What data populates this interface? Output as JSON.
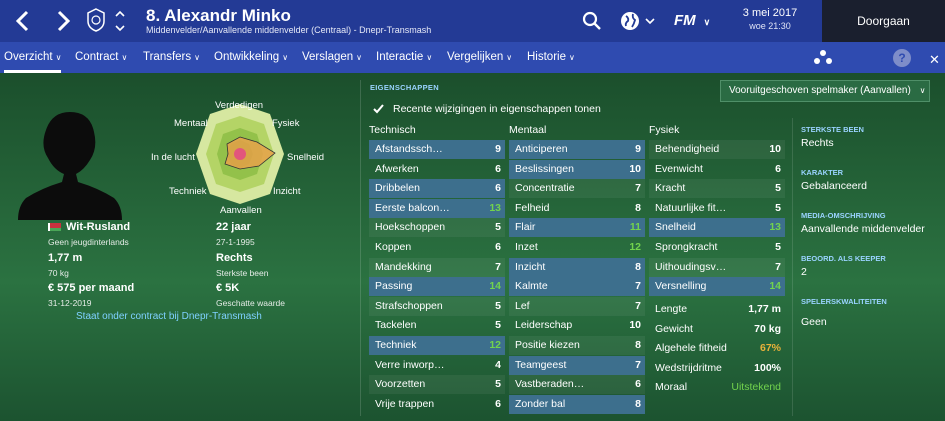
{
  "colors": {
    "topbar": "#233a95",
    "tabbar": "#2f4bb0",
    "continue_bg": "#1a1f2e",
    "highlight_row": "#3d6f8d",
    "good_value": "#72d34d",
    "ok_value": "#ffffff",
    "accent_label": "#9ad3ff",
    "link": "#7fd1ff",
    "orange": "#e9b23a"
  },
  "header": {
    "title": "8. Alexandr Minko",
    "subtitle": "Middenvelder/Aanvallende middenvelder (Centraal) - Dnepr-Transmash",
    "date": "3 mei 2017",
    "time": "woe 21:30",
    "continue_label": "Doorgaan",
    "icons": [
      "back-arrow-icon",
      "forward-arrow-icon",
      "club-crest-icon",
      "search-icon",
      "globe-icon",
      "fm-logo-icon"
    ],
    "fm_label": "FM"
  },
  "tabs": [
    {
      "label": "Overzicht",
      "active": true
    },
    {
      "label": "Contract"
    },
    {
      "label": "Transfers"
    },
    {
      "label": "Ontwikkeling"
    },
    {
      "label": "Verslagen"
    },
    {
      "label": "Interactie"
    },
    {
      "label": "Vergelijken"
    },
    {
      "label": "Historie"
    }
  ],
  "tab_icons": {
    "squad": "squad-icon",
    "help": "?",
    "close": "✕"
  },
  "radar": {
    "labels": {
      "top": "Verdedigen",
      "top_left": "Mentaal",
      "top_right": "Fysiek",
      "left": "In de lucht",
      "right": "Snelheid",
      "bottom_left": "Techniek",
      "bottom_right": "Inzicht",
      "bottom": "Aanvallen"
    }
  },
  "player": {
    "nationality": "Wit-Rusland",
    "caps": "Geen jeugdinterlands",
    "age": "22 jaar",
    "dob": "27-1-1995",
    "height": "1,77 m",
    "weight": "70 kg",
    "foot": "Rechts",
    "foot_sub": "Sterkste been",
    "wage": "€ 575 per maand",
    "contract_end": "31-12-2019",
    "value": "€ 5K",
    "value_sub": "Geschatte waarde",
    "contract_link": "Staat onder contract bij Dnepr-Transmash"
  },
  "attributes": {
    "section_label": "EIGENSCHAPPEN",
    "checkbox_label": "Recente wijzigingen in eigenschappen tonen",
    "role_select": "Vooruitgeschoven spelmaker (Aanvallen)",
    "technical_head": "Technisch",
    "mental_head": "Mentaal",
    "physical_head": "Fysiek",
    "technical": [
      {
        "name": "Afstandssch…",
        "val": "9",
        "hl": true
      },
      {
        "name": "Afwerken",
        "val": "6"
      },
      {
        "name": "Dribbelen",
        "val": "6",
        "hl": true
      },
      {
        "name": "Eerste balcon…",
        "val": "13",
        "hl": true
      },
      {
        "name": "Hoekschoppen",
        "val": "5"
      },
      {
        "name": "Koppen",
        "val": "6"
      },
      {
        "name": "Mandekking",
        "val": "7"
      },
      {
        "name": "Passing",
        "val": "14",
        "hl": true
      },
      {
        "name": "Strafschoppen",
        "val": "5"
      },
      {
        "name": "Tackelen",
        "val": "5"
      },
      {
        "name": "Techniek",
        "val": "12",
        "hl": true
      },
      {
        "name": "Verre inworp…",
        "val": "4"
      },
      {
        "name": "Voorzetten",
        "val": "5"
      },
      {
        "name": "Vrije trappen",
        "val": "6"
      }
    ],
    "mental": [
      {
        "name": "Anticiperen",
        "val": "9",
        "hl": true
      },
      {
        "name": "Beslissingen",
        "val": "10",
        "hl": true
      },
      {
        "name": "Concentratie",
        "val": "7"
      },
      {
        "name": "Felheid",
        "val": "8"
      },
      {
        "name": "Flair",
        "val": "11",
        "hl": true
      },
      {
        "name": "Inzet",
        "val": "12"
      },
      {
        "name": "Inzicht",
        "val": "8",
        "hl": true
      },
      {
        "name": "Kalmte",
        "val": "7",
        "hl": true
      },
      {
        "name": "Lef",
        "val": "7"
      },
      {
        "name": "Leiderschap",
        "val": "10"
      },
      {
        "name": "Positie kiezen",
        "val": "8"
      },
      {
        "name": "Teamgeest",
        "val": "7",
        "hl": true
      },
      {
        "name": "Vastberaden…",
        "val": "6"
      },
      {
        "name": "Zonder bal",
        "val": "8",
        "hl": true
      }
    ],
    "physical": [
      {
        "name": "Behendigheid",
        "val": "10"
      },
      {
        "name": "Evenwicht",
        "val": "6"
      },
      {
        "name": "Kracht",
        "val": "5"
      },
      {
        "name": "Natuurlijke fit…",
        "val": "5"
      },
      {
        "name": "Snelheid",
        "val": "13",
        "hl": true
      },
      {
        "name": "Sprongkracht",
        "val": "5"
      },
      {
        "name": "Uithoudingsv…",
        "val": "7"
      },
      {
        "name": "Versnelling",
        "val": "14",
        "hl": true
      }
    ],
    "physical_extra": [
      {
        "name": "Lengte",
        "val": "1,77 m"
      },
      {
        "name": "Gewicht",
        "val": "70 kg"
      },
      {
        "name": "Algehele fitheid",
        "val": "67%"
      },
      {
        "name": "Wedstrijdritme",
        "val": "100%"
      },
      {
        "name": "Moraal",
        "val": "Uitstekend"
      }
    ]
  },
  "side": {
    "strong_foot_label": "STERKSTE BEEN",
    "strong_foot": "Rechts",
    "character_label": "KARAKTER",
    "character": "Gebalanceerd",
    "media_label": "MEDIA-OMSCHRIJVING",
    "media": "Aanvallende middenvelder",
    "keeper_label": "BEOORD. ALS KEEPER",
    "keeper": "2",
    "qualities_label": "SPELERSKWALITEITEN",
    "qualities": "Geen"
  }
}
